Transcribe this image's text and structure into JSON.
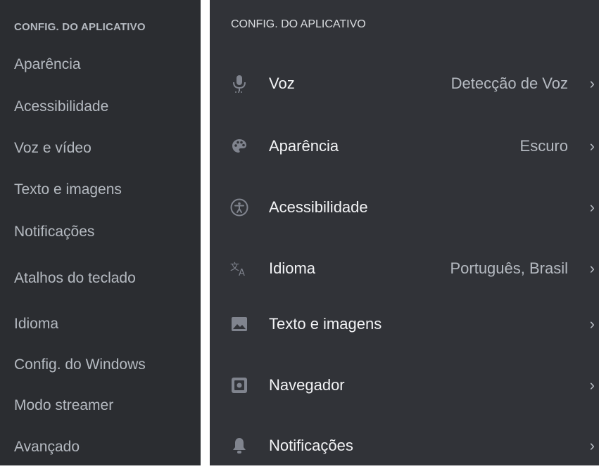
{
  "sidebar": {
    "header": "CONFIG. DO APLICATIVO",
    "items": [
      {
        "label": "Aparência"
      },
      {
        "label": "Acessibilidade"
      },
      {
        "label": "Voz e vídeo"
      },
      {
        "label": "Texto e imagens"
      },
      {
        "label": "Notificações"
      },
      {
        "label": "Atalhos do teclado"
      },
      {
        "label": "Idioma"
      },
      {
        "label": "Config. do Windows"
      },
      {
        "label": "Modo streamer"
      },
      {
        "label": "Avançado"
      }
    ]
  },
  "settings": {
    "header": "CONFIG. DO APLICATIVO",
    "rows": [
      {
        "label": "Voz",
        "value": "Detecção de Voz",
        "icon": "microphone-icon"
      },
      {
        "label": "Aparência",
        "value": "Escuro",
        "icon": "palette-icon"
      },
      {
        "label": "Acessibilidade",
        "value": "",
        "icon": "accessibility-icon"
      },
      {
        "label": "Idioma",
        "value": "Português, Brasil",
        "icon": "translate-icon"
      },
      {
        "label": "Texto e imagens",
        "value": "",
        "icon": "image-icon"
      },
      {
        "label": "Navegador",
        "value": "",
        "icon": "browser-icon"
      },
      {
        "label": "Notificações",
        "value": "",
        "icon": "bell-icon"
      }
    ],
    "chevron": "›"
  },
  "colors": {
    "sidebar_bg": "#2b2d31",
    "panel_bg": "#313338",
    "text_primary": "#f2f3f5",
    "text_muted": "#b5bac1",
    "icon": "#80848e"
  }
}
